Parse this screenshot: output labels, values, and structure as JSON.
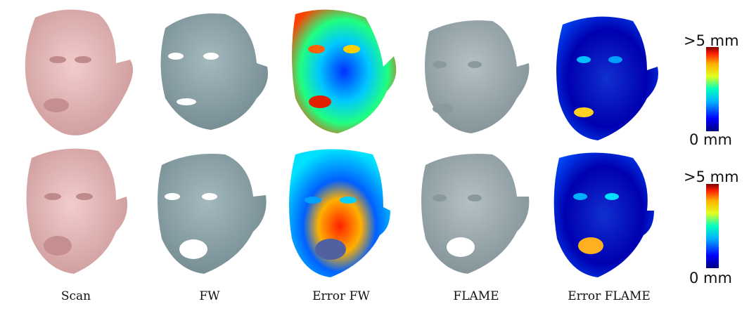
{
  "columns": [
    "Scan",
    "FW",
    "Error FW",
    "FLAME",
    "Error FLAME"
  ],
  "colorbars": [
    {
      "max_label": ">5 mm",
      "min_label": "0 mm"
    },
    {
      "max_label": ">5 mm",
      "min_label": "0 mm"
    }
  ],
  "colors": {
    "scan_skin": "#e8b8b8",
    "model_gray": "#8fa6ac",
    "flame_gray": "#9aa8ad",
    "colormap": [
      "#000080",
      "#0000ff",
      "#00b0ff",
      "#00ffc0",
      "#e0ff20",
      "#ffb000",
      "#ff2000",
      "#800000"
    ]
  }
}
